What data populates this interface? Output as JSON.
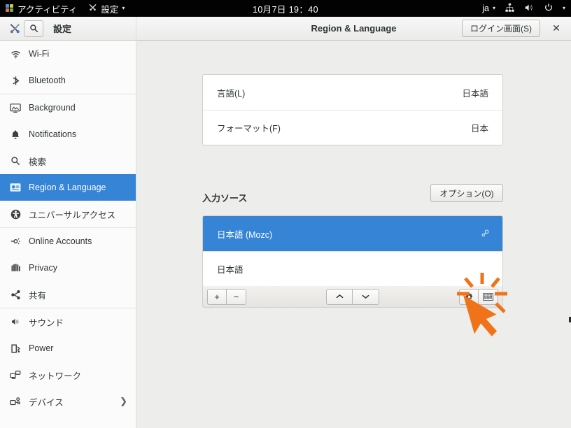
{
  "topbar": {
    "activities": "アクティビティ",
    "app_menu": "設定",
    "clock": "10月7日 19：40",
    "keyboard_layout": "ja",
    "icons": [
      "activities-logo-icon",
      "app-menu-caret-icon",
      "network-wired-icon",
      "volume-icon",
      "power-icon",
      "system-menu-caret-icon"
    ]
  },
  "headerbar": {
    "tools_icon": "tools-icon",
    "search_icon": "search-icon",
    "sidebar_title": "設定",
    "window_title": "Region & Language",
    "login_screen_button": "ログイン画面(S)",
    "close_button": "✕"
  },
  "sidebar": {
    "items": [
      {
        "label": "Wi-Fi",
        "icon": "wifi-icon",
        "selected": false,
        "chevron": false
      },
      {
        "label": "Bluetooth",
        "icon": "bluetooth-icon",
        "selected": false,
        "chevron": false
      },
      {
        "label": "Background",
        "icon": "background-icon",
        "selected": false,
        "chevron": false,
        "separator_before": true
      },
      {
        "label": "Notifications",
        "icon": "bell-icon",
        "selected": false,
        "chevron": false
      },
      {
        "label": "検索",
        "icon": "search-icon",
        "selected": false,
        "chevron": false
      },
      {
        "label": "Region & Language",
        "icon": "region-language-icon",
        "selected": true,
        "chevron": false
      },
      {
        "label": "ユニバーサルアクセス",
        "icon": "universal-access-icon",
        "selected": false,
        "chevron": false
      },
      {
        "label": "Online Accounts",
        "icon": "online-accounts-icon",
        "selected": false,
        "chevron": false,
        "separator_before": true
      },
      {
        "label": "Privacy",
        "icon": "privacy-hand-icon",
        "selected": false,
        "chevron": false
      },
      {
        "label": "共有",
        "icon": "sharing-icon",
        "selected": false,
        "chevron": false
      },
      {
        "label": "サウンド",
        "icon": "sound-icon",
        "selected": false,
        "chevron": false,
        "separator_before": true
      },
      {
        "label": "Power",
        "icon": "power-battery-icon",
        "selected": false,
        "chevron": false
      },
      {
        "label": "ネットワーク",
        "icon": "network-icon",
        "selected": false,
        "chevron": false
      },
      {
        "label": "デバイス",
        "icon": "devices-icon",
        "selected": false,
        "chevron": true
      }
    ]
  },
  "main": {
    "language_rows": [
      {
        "key": "言語(L)",
        "value": "日本語"
      },
      {
        "key": "フォーマット(F)",
        "value": "日本"
      }
    ],
    "input_sources_heading": "入力ソース",
    "options_button": "オプション(O)",
    "input_sources": [
      {
        "label": "日本語 (Mozc)",
        "selected": true,
        "gear": "preferences-icon"
      },
      {
        "label": "日本語",
        "selected": false,
        "gear": null
      }
    ],
    "toolbar": {
      "add_button": "+",
      "remove_button": "−",
      "move_up_button": "⌃",
      "move_down_button": "⌄",
      "settings_button": "gear-icon",
      "keyboard_preview_button": "keyboard-icon"
    }
  },
  "cursor": {
    "state": "clicking",
    "target": "move-up-button",
    "color": "#f07219"
  },
  "colors": {
    "accent_blue": "#3584d6",
    "topbar_black": "#020202",
    "window_bg": "#ededeb",
    "sidebar_bg": "#fbfbfb",
    "card_bg": "#ffffff",
    "cursor_orange": "#f07219"
  }
}
